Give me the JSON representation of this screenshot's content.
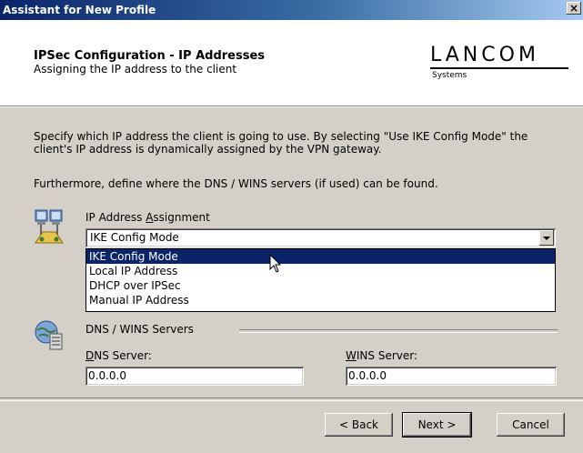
{
  "window": {
    "title": "Assistant for New Profile",
    "close_label": "×"
  },
  "header": {
    "title": "IPSec Configuration - IP Addresses",
    "subtitle": "Assigning the IP address to the client",
    "logo_brand": "LANCOM",
    "logo_sub": "Systems"
  },
  "body": {
    "description1": "Specify which IP address the client is going to use. By selecting \"Use IKE Config Mode\" the client's IP address is dynamically assigned by the VPN gateway.",
    "description2": "Furthermore, define where the DNS / WINS servers (if used) can be found."
  },
  "ip_assignment": {
    "label_pre": "IP Address ",
    "label_ul": "A",
    "label_post": "ssignment",
    "selected": "IKE Config Mode",
    "options": [
      "IKE Config Mode",
      "Local IP Address",
      "DHCP over IPSec",
      "Manual IP Address"
    ]
  },
  "dns_wins": {
    "group_label": "DNS / WINS Servers",
    "dns_label_ul": "D",
    "dns_label_post": "NS Server:",
    "dns_value": "0.0.0.0",
    "wins_label_ul": "W",
    "wins_label_post": "INS Server:",
    "wins_value": "0.0.0.0"
  },
  "buttons": {
    "back": "< Back",
    "next": "Next >",
    "cancel": "Cancel"
  },
  "colors": {
    "title_start": "#0a246a",
    "title_end": "#a6caf0",
    "selection": "#0a246a",
    "face": "#d4d0c8"
  }
}
